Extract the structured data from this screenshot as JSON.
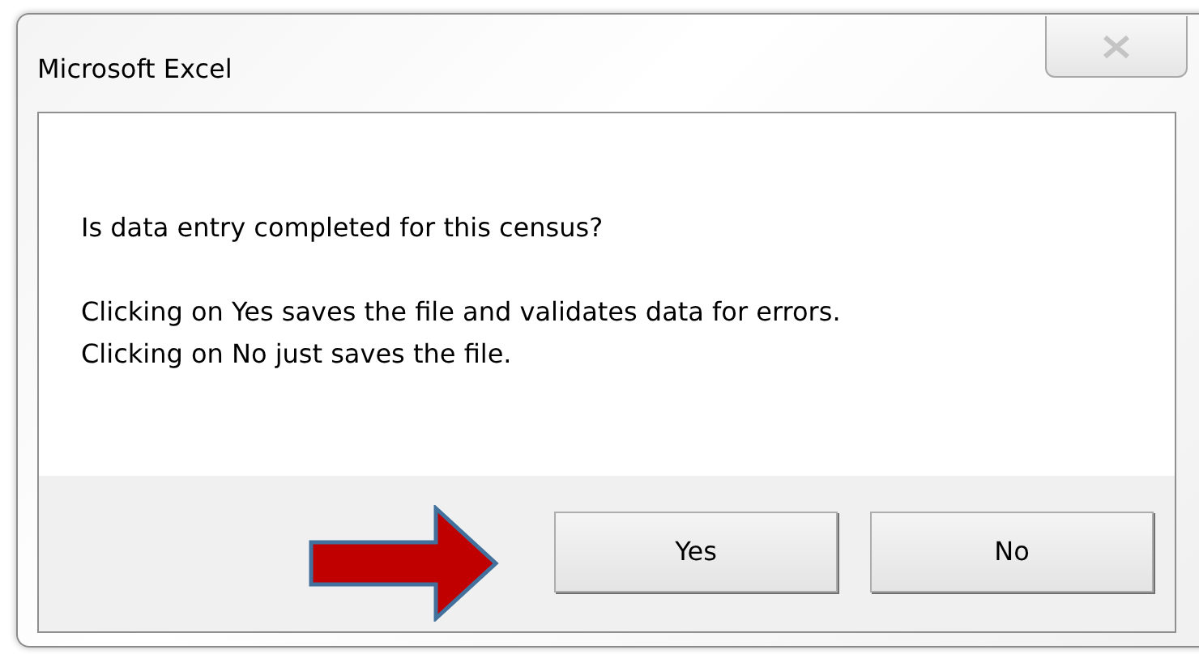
{
  "window": {
    "title": "Microsoft Excel",
    "close_disabled": true
  },
  "message": {
    "question": "Is data entry completed for this census?",
    "details": [
      "Clicking on Yes saves the file and validates data for errors.",
      "Clicking on No just saves the file."
    ]
  },
  "buttons": [
    {
      "label": "Yes"
    },
    {
      "label": "No"
    }
  ]
}
